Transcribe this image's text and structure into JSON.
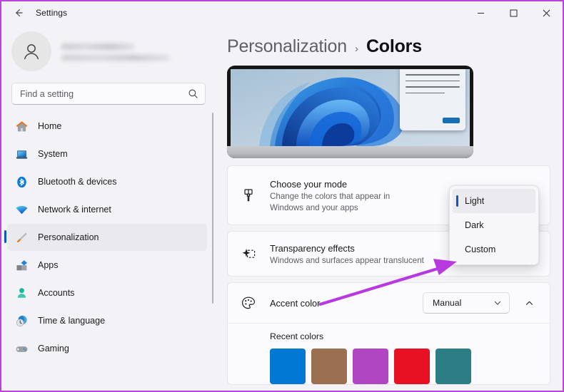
{
  "window": {
    "title": "Settings",
    "back_icon": "back-arrow-icon",
    "minimize_label": "Minimize",
    "maximize_label": "Maximize",
    "close_label": "Close"
  },
  "account": {
    "name_redacted": true,
    "email_redacted": true,
    "avatar_icon": "person-avatar-icon"
  },
  "search": {
    "placeholder": "Find a setting",
    "value": "",
    "icon": "search-icon"
  },
  "sidebar": {
    "items": [
      {
        "label": "Home",
        "icon": "home-icon",
        "active": false
      },
      {
        "label": "System",
        "icon": "system-laptop-icon",
        "active": false
      },
      {
        "label": "Bluetooth & devices",
        "icon": "bluetooth-icon",
        "active": false
      },
      {
        "label": "Network & internet",
        "icon": "wifi-icon",
        "active": false
      },
      {
        "label": "Personalization",
        "icon": "paintbrush-icon",
        "active": true
      },
      {
        "label": "Apps",
        "icon": "apps-grid-icon",
        "active": false
      },
      {
        "label": "Accounts",
        "icon": "accounts-person-icon",
        "active": false
      },
      {
        "label": "Time & language",
        "icon": "clock-globe-icon",
        "active": false
      },
      {
        "label": "Gaming",
        "icon": "gamepad-icon",
        "active": false
      }
    ]
  },
  "breadcrumb": {
    "parent": "Personalization",
    "separator": "›",
    "current": "Colors"
  },
  "preview": {
    "alt": "windows-11-bloom-wallpaper-preview"
  },
  "settings": {
    "mode": {
      "icon": "paint-bucket-icon",
      "title": "Choose your mode",
      "description_line1": "Change the colors that appear in",
      "description_line2": "Windows and your apps"
    },
    "transparency": {
      "icon": "transparency-sparkle-icon",
      "title": "Transparency effects",
      "description": "Windows and surfaces appear translucent"
    },
    "accent": {
      "icon": "color-palette-icon",
      "title": "Accent color",
      "combo_value": "Manual",
      "combo_chevron": "chevron-down-icon",
      "expander_chevron": "chevron-up-icon",
      "recent_colors_label": "Recent colors",
      "recent_colors": [
        {
          "name": "blue",
          "hex": "#0078D4"
        },
        {
          "name": "brown",
          "hex": "#9A7051"
        },
        {
          "name": "purple",
          "hex": "#B146C2"
        },
        {
          "name": "red",
          "hex": "#E81123"
        },
        {
          "name": "teal",
          "hex": "#2D7D85"
        }
      ]
    }
  },
  "mode_dropdown": {
    "open": true,
    "options": [
      {
        "label": "Light",
        "selected": true
      },
      {
        "label": "Dark",
        "selected": false
      },
      {
        "label": "Custom",
        "selected": false
      }
    ]
  },
  "annotation": {
    "arrow_color": "#b839e0",
    "points_to": "Custom",
    "border_color": "#bb44dd"
  }
}
